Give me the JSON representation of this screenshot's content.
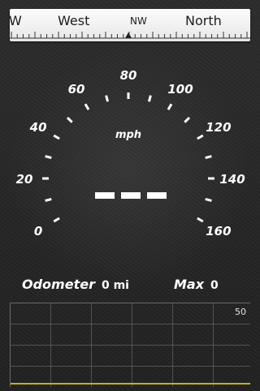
{
  "compass": {
    "labels": {
      "w_partial": "W",
      "west": "West",
      "nw": "NW",
      "north": "North"
    }
  },
  "gauge": {
    "unit": "mph",
    "min": 0,
    "max": 160,
    "major_step": 20,
    "scale_labels": [
      "0",
      "20",
      "40",
      "60",
      "80",
      "100",
      "120",
      "140",
      "160"
    ],
    "speed_value": "---",
    "speed_fraction": 0
  },
  "info": {
    "odometer_label": "Odometer",
    "odometer_value": "0 mi",
    "max_label": "Max",
    "max_value": "0"
  },
  "graph": {
    "max_label": "50",
    "line_color": "#c8b20a"
  },
  "colors": {
    "background": "#262626",
    "compass_bg": "#f2f2f2",
    "text": "#ffffff",
    "graph_line": "#c8b20a"
  }
}
